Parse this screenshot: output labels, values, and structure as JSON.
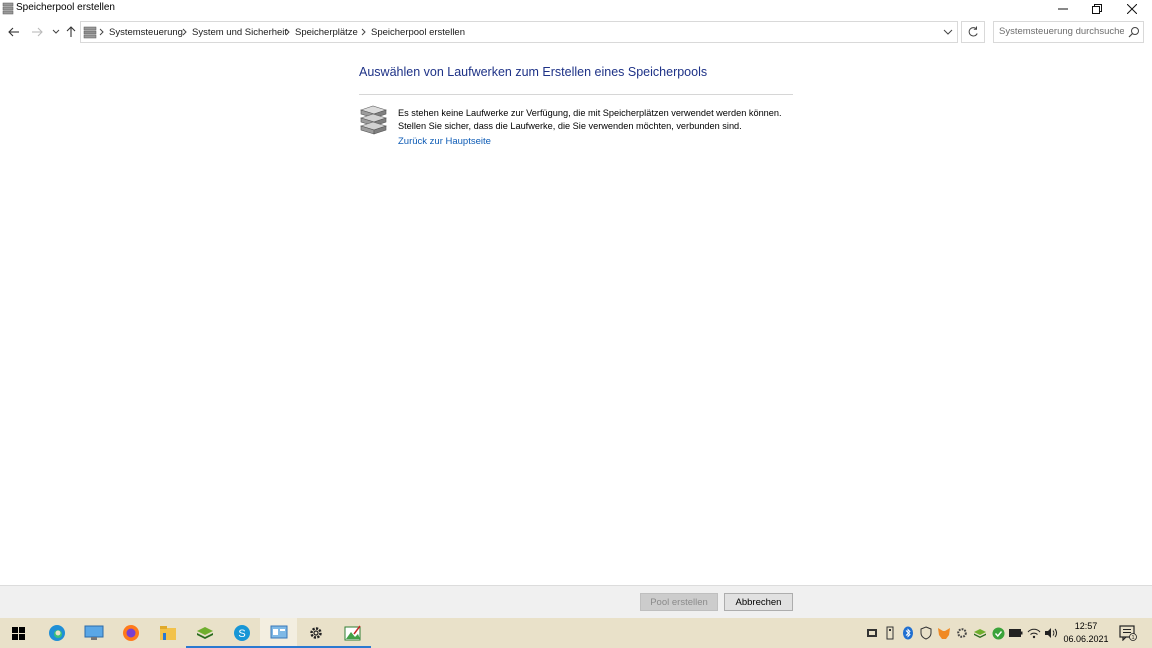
{
  "window": {
    "title": "Speicherpool erstellen"
  },
  "breadcrumb": {
    "items": [
      "Systemsteuerung",
      "System und Sicherheit",
      "Speicherplätze",
      "Speicherpool erstellen"
    ]
  },
  "search": {
    "placeholder": "Systemsteuerung durchsuchen"
  },
  "main": {
    "heading": "Auswählen von Laufwerken zum Erstellen eines Speicherpools",
    "message_line1": "Es stehen keine Laufwerke zur Verfügung, die mit Speicherplätzen verwendet werden können.",
    "message_line2": "Stellen Sie sicher, dass die Laufwerke, die Sie verwenden möchten, verbunden sind.",
    "back_link": "Zurück zur Hauptseite"
  },
  "buttons": {
    "create_pool": "Pool erstellen",
    "cancel": "Abbrechen"
  },
  "taskbar": {
    "clock_time": "12:57",
    "clock_date": "06.06.2021",
    "notification_count": "1"
  },
  "colors": {
    "heading": "#1e3287",
    "link": "#0d5bb5",
    "taskbar": "#e9e1c9",
    "accent": "#2b79d0"
  }
}
